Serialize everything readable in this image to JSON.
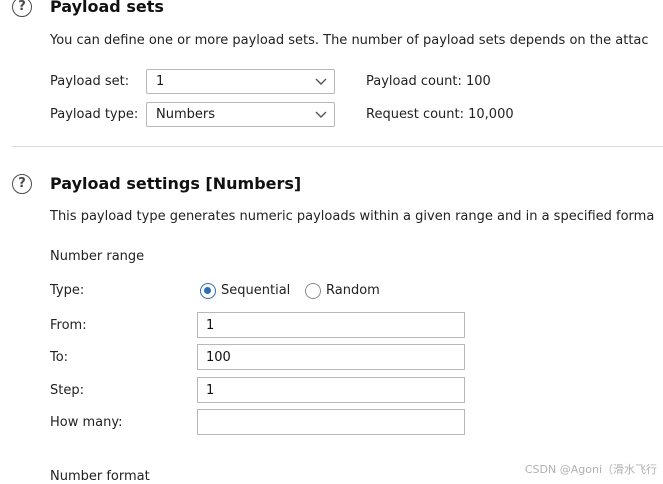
{
  "payload_sets": {
    "title": "Payload sets",
    "description": "You can define one or more payload sets. The number of payload sets depends on the attac",
    "payload_set_label": "Payload set:",
    "payload_set_value": "1",
    "payload_type_label": "Payload type:",
    "payload_type_value": "Numbers",
    "payload_count": "Payload count: 100",
    "request_count": "Request count: 10,000"
  },
  "payload_settings": {
    "title": "Payload settings [Numbers]",
    "description": "This payload type generates numeric payloads within a given range and in a specified forma",
    "number_range_heading": "Number range",
    "type_label": "Type:",
    "type_options": [
      "Sequential",
      "Random"
    ],
    "type_selected": "Sequential",
    "from_label": "From:",
    "from_value": "1",
    "to_label": "To:",
    "to_value": "100",
    "step_label": "Step:",
    "step_value": "1",
    "how_many_label": "How many:",
    "how_many_value": "",
    "number_format_heading": "Number format"
  },
  "icons": {
    "help": "help-circle-icon",
    "dropdown": "chevron-down-icon"
  },
  "colors": {
    "accent": "#2c6fb0",
    "divider": "#dadada"
  },
  "watermark": "CSDN @Agoni（滑水飞行"
}
